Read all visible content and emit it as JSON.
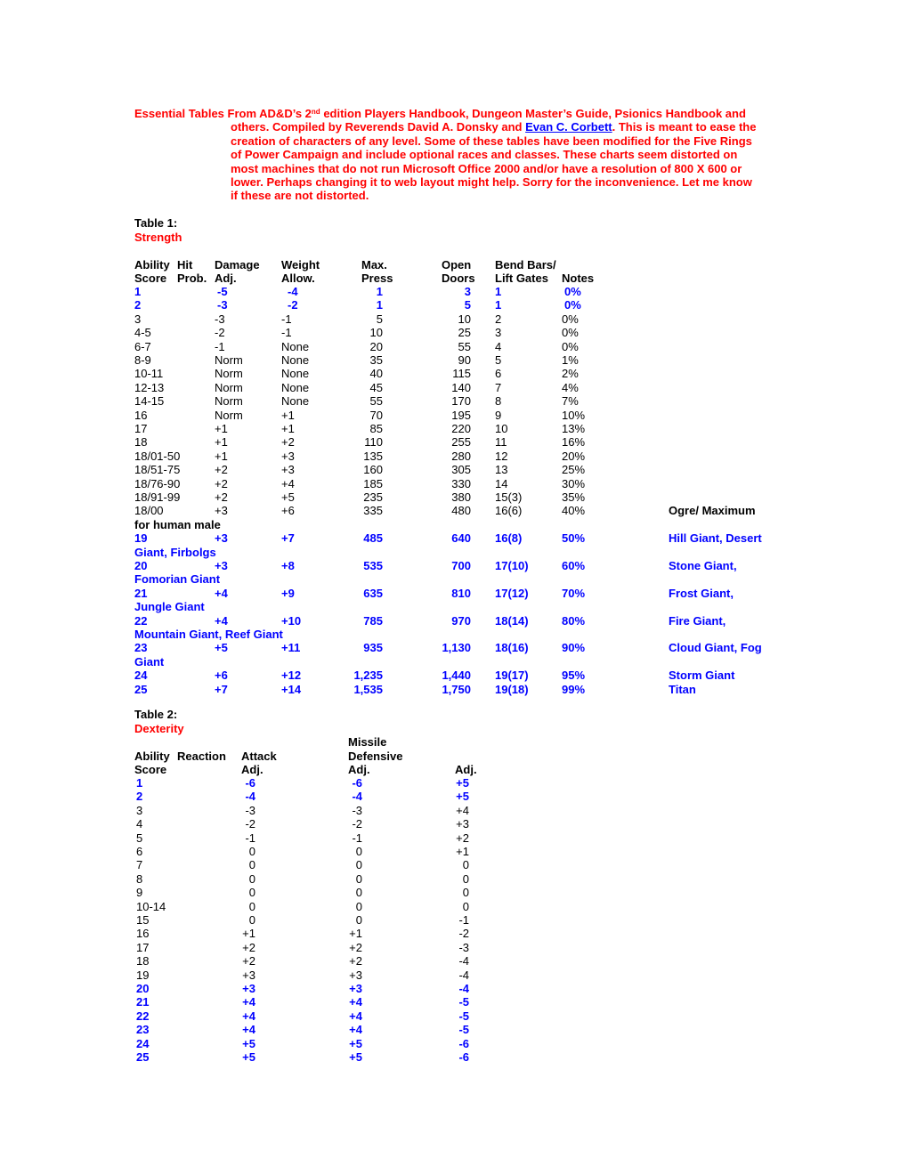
{
  "intro": {
    "title_pre": "Essential Tables From AD&D’s 2",
    "title_sup": "nd",
    "title_post": " edition Players Handbook,  Dungeon Master’s Guide, Psionics Handbook and",
    "line2_pre": "others. Compiled by Reverends David A. Donsky and ",
    "link": "Evan C. Corbett",
    "line2_post": ". This is meant to ease the",
    "line3": "creation of characters of any level. Some of these tables have been modified for the Five Rings",
    "line4": "of Power Campaign and include optional races and classes. These charts seem distorted on",
    "line5": "most machines that do not run Microsoft Office 2000 and/or have a resolution of 800 X 600 or",
    "line6": "lower. Perhaps changing it to web layout might help. Sorry for the inconvenience. Let me know",
    "line7": "if these are not distorted."
  },
  "table1": {
    "label": "Table 1:",
    "title": "Strength",
    "headers_row1": [
      "Ability",
      "Hit",
      "Damage",
      "Weight",
      "Max.",
      "Open",
      "Bend Bars/"
    ],
    "headers_row2": [
      "Score",
      "Prob.",
      "Adj.",
      "Allow.",
      "Press",
      "Doors",
      "Lift Gates",
      "Notes"
    ],
    "rows": [
      {
        "score": "1",
        "hit": "-5",
        "dmg": "-4",
        "weight": "1",
        "press": "3",
        "doors": "1",
        "bend": "0%",
        "notes": "",
        "style": "blue"
      },
      {
        "score": "2",
        "hit": "-3",
        "dmg": "-2",
        "weight": "1",
        "press": "5",
        "doors": "1",
        "bend": "0%",
        "notes": "",
        "style": "blue"
      },
      {
        "score": "3",
        "hit": "-3",
        "dmg": "-1",
        "weight": "5",
        "press": "10",
        "doors": "2",
        "bend": "0%",
        "notes": "",
        "style": "plain"
      },
      {
        "score": "4-5",
        "hit": "-2",
        "dmg": "-1",
        "weight": "10",
        "press": "25",
        "doors": "3",
        "bend": "0%",
        "notes": "",
        "style": "plain"
      },
      {
        "score": "6-7",
        "hit": "-1",
        "dmg": "None",
        "weight": "20",
        "press": "55",
        "doors": "4",
        "bend": "0%",
        "notes": "",
        "style": "plain"
      },
      {
        "score": "8-9",
        "hit": "Norm",
        "dmg": "None",
        "weight": "35",
        "press": "90",
        "doors": "5",
        "bend": "1%",
        "notes": "",
        "style": "plain"
      },
      {
        "score": "10-11",
        "hit": "Norm",
        "dmg": "None",
        "weight": "40",
        "press": "115",
        "doors": "6",
        "bend": "2%",
        "notes": "",
        "style": "plain"
      },
      {
        "score": "12-13",
        "hit": "Norm",
        "dmg": "None",
        "weight": "45",
        "press": "140",
        "doors": "7",
        "bend": "4%",
        "notes": "",
        "style": "plain"
      },
      {
        "score": "14-15",
        "hit": "Norm",
        "dmg": "None",
        "weight": "55",
        "press": "170",
        "doors": "8",
        "bend": "7%",
        "notes": "",
        "style": "plain"
      },
      {
        "score": "16",
        "hit": "Norm",
        "dmg": "+1",
        "weight": "70",
        "press": "195",
        "doors": "9",
        "bend": "10%",
        "notes": "",
        "style": "plain"
      },
      {
        "score": "17",
        "hit": "+1",
        "dmg": "+1",
        "weight": "85",
        "press": "220",
        "doors": "10",
        "bend": "13%",
        "notes": "",
        "style": "plain"
      },
      {
        "score": "18",
        "hit": "+1",
        "dmg": "+2",
        "weight": "110",
        "press": "255",
        "doors": "11",
        "bend": "16%",
        "notes": "",
        "style": "plain"
      },
      {
        "score": "18/01-50",
        "hit": "+1",
        "dmg": "+3",
        "weight": "135",
        "press": "280",
        "doors": "12",
        "bend": "20%",
        "notes": "",
        "style": "plain"
      },
      {
        "score": "18/51-75",
        "hit": "+2",
        "dmg": "+3",
        "weight": "160",
        "press": "305",
        "doors": "13",
        "bend": "25%",
        "notes": "",
        "style": "plain"
      },
      {
        "score": "18/76-90",
        "hit": "+2",
        "dmg": "+4",
        "weight": "185",
        "press": "330",
        "doors": "14",
        "bend": "30%",
        "notes": "",
        "style": "plain"
      },
      {
        "score": "18/91-99",
        "hit": "+2",
        "dmg": "+5",
        "weight": "235",
        "press": "380",
        "doors": "15(3)",
        "bend": "35%",
        "notes": "",
        "style": "plain"
      },
      {
        "score": "18/00",
        "hit": "+3",
        "dmg": "+6",
        "weight": "335",
        "press": "480",
        "doors": "16(6)",
        "bend": "40%",
        "notes": "Ogre/ Maximum",
        "notes_wrap": "for human male",
        "style": "plain-bold-notes"
      },
      {
        "score": "19",
        "hit": "+3",
        "dmg": "+7",
        "weight": "485",
        "press": "640",
        "doors": "16(8)",
        "bend": "50%",
        "notes": "Hill Giant, Desert",
        "notes_wrap": "Giant, Firbolgs",
        "style": "blue"
      },
      {
        "score": "20",
        "hit": "+3",
        "dmg": "+8",
        "weight": "535",
        "press": "700",
        "doors": "17(10)",
        "bend": "60%",
        "notes": "Stone Giant,",
        "notes_wrap": "Fomorian Giant",
        "style": "blue"
      },
      {
        "score": "21",
        "hit": "+4",
        "dmg": "+9",
        "weight": "635",
        "press": "810",
        "doors": "17(12)",
        "bend": "70%",
        "notes": "Frost Giant,",
        "notes_wrap": "Jungle Giant",
        "style": "blue"
      },
      {
        "score": "22",
        "hit": "+4",
        "dmg": "+10",
        "weight": "785",
        "press": "970",
        "doors": "18(14)",
        "bend": "80%",
        "notes": "Fire Giant,",
        "notes_wrap": "Mountain Giant, Reef Giant",
        "style": "blue"
      },
      {
        "score": "23",
        "hit": "+5",
        "dmg": "+11",
        "weight": "935",
        "press": "1,130",
        "doors": "18(16)",
        "bend": "90%",
        "notes": "Cloud Giant, Fog",
        "notes_wrap": "Giant",
        "style": "blue"
      },
      {
        "score": "24",
        "hit": "+6",
        "dmg": "+12",
        "weight": "1,235",
        "press": "1,440",
        "doors": "19(17)",
        "bend": "95%",
        "notes": "Storm Giant",
        "style": "blue"
      },
      {
        "score": "25",
        "hit": "+7",
        "dmg": "+14",
        "weight": "1,535",
        "press": "1,750",
        "doors": "19(18)",
        "bend": "99%",
        "notes": "Titan",
        "style": "blue"
      }
    ]
  },
  "table2": {
    "label": "Table 2:",
    "title": "Dexterity",
    "header_top": "Missile",
    "headers_row1": [
      "Ability",
      "Reaction",
      "Attack",
      "Defensive"
    ],
    "headers_row2": [
      "Score",
      "Adj.",
      "Adj.",
      "Adj."
    ],
    "rows": [
      {
        "score": "1",
        "reaction": "-6",
        "missile": "-6",
        "defense": "+5",
        "style": "blue"
      },
      {
        "score": "2",
        "reaction": "-4",
        "missile": "-4",
        "defense": "+5",
        "style": "blue"
      },
      {
        "score": "3",
        "reaction": "-3",
        "missile": "-3",
        "defense": "+4",
        "style": "plain"
      },
      {
        "score": "4",
        "reaction": "-2",
        "missile": "-2",
        "defense": "+3",
        "style": "plain"
      },
      {
        "score": "5",
        "reaction": "-1",
        "missile": "-1",
        "defense": "+2",
        "style": "plain"
      },
      {
        "score": "6",
        "reaction": "0",
        "missile": "0",
        "defense": "+1",
        "style": "plain"
      },
      {
        "score": "7",
        "reaction": "0",
        "missile": "0",
        "defense": "0",
        "style": "plain"
      },
      {
        "score": "8",
        "reaction": "0",
        "missile": "0",
        "defense": "0",
        "style": "plain"
      },
      {
        "score": "9",
        "reaction": "0",
        "missile": "0",
        "defense": "0",
        "style": "plain"
      },
      {
        "score": "10-14",
        "reaction": "0",
        "missile": "0",
        "defense": "0",
        "style": "plain"
      },
      {
        "score": "15",
        "reaction": "0",
        "missile": "0",
        "defense": "-1",
        "style": "plain"
      },
      {
        "score": "16",
        "reaction": "+1",
        "missile": "+1",
        "defense": "-2",
        "style": "plain"
      },
      {
        "score": "17",
        "reaction": "+2",
        "missile": "+2",
        "defense": "-3",
        "style": "plain"
      },
      {
        "score": "18",
        "reaction": "+2",
        "missile": "+2",
        "defense": "-4",
        "style": "plain"
      },
      {
        "score": "19",
        "reaction": "+3",
        "missile": "+3",
        "defense": "-4",
        "style": "plain"
      },
      {
        "score": "20",
        "reaction": "+3",
        "missile": "+3",
        "defense": "-4",
        "style": "blue"
      },
      {
        "score": "21",
        "reaction": "+4",
        "missile": "+4",
        "defense": "-5",
        "style": "blue"
      },
      {
        "score": "22",
        "reaction": "+4",
        "missile": "+4",
        "defense": "-5",
        "style": "blue"
      },
      {
        "score": "23",
        "reaction": "+4",
        "missile": "+4",
        "defense": "-5",
        "style": "blue"
      },
      {
        "score": "24",
        "reaction": "+5",
        "missile": "+5",
        "defense": "-6",
        "style": "blue"
      },
      {
        "score": "25",
        "reaction": "+5",
        "missile": "+5",
        "defense": "-6",
        "style": "blue"
      }
    ]
  }
}
